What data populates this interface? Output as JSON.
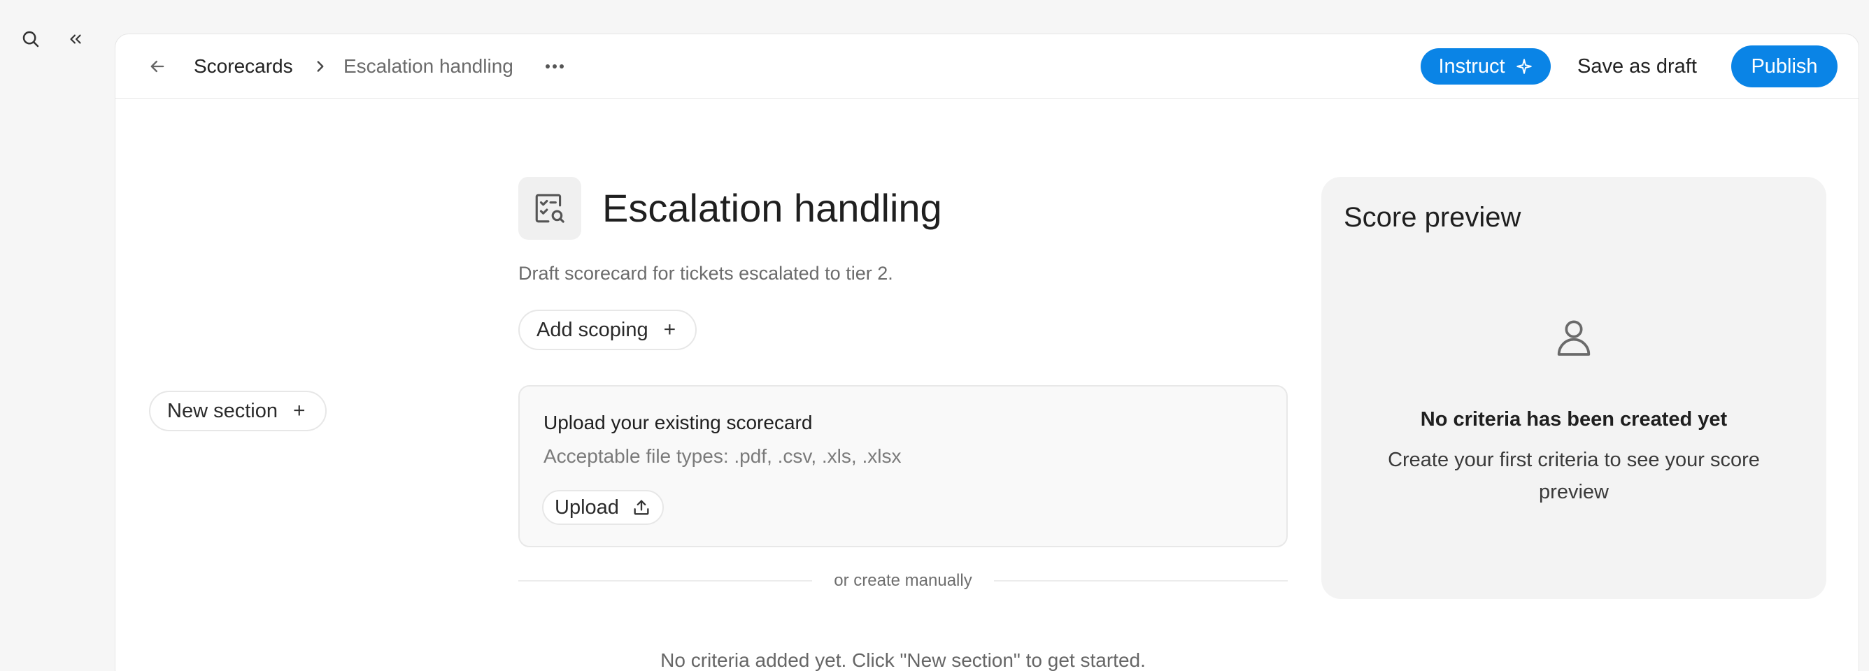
{
  "rail": {
    "search_icon": "search-icon",
    "collapse_icon": "collapse-sidebar-icon"
  },
  "topbar": {
    "back_icon": "arrow-left-icon",
    "breadcrumb_root": "Scorecards",
    "breadcrumb_current": "Escalation handling",
    "more_icon": "more-horizontal-icon",
    "instruct_label": "Instruct",
    "save_draft_label": "Save as draft",
    "publish_label": "Publish"
  },
  "sidebar": {
    "new_section_label": "New section"
  },
  "main": {
    "title": "Escalation handling",
    "title_icon": "scorecard-search-icon",
    "description": "Draft scorecard for tickets escalated to tier 2.",
    "add_scoping_label": "Add scoping",
    "upload": {
      "title": "Upload your existing scorecard",
      "file_types": "Acceptable file types: .pdf, .csv, .xls, .xlsx",
      "button_label": "Upload"
    },
    "divider_label": "or create manually",
    "empty_text": "No criteria added yet. Click \"New section\" to get started."
  },
  "preview": {
    "title": "Score preview",
    "empty_title": "No criteria has been created yet",
    "empty_line1": "Create your first criteria to see your score",
    "empty_line2": "preview"
  },
  "colors": {
    "accent": "#0a84e6",
    "panel": "#ffffff",
    "background": "#f6f6f6",
    "preview_bg": "#f3f3f3"
  }
}
